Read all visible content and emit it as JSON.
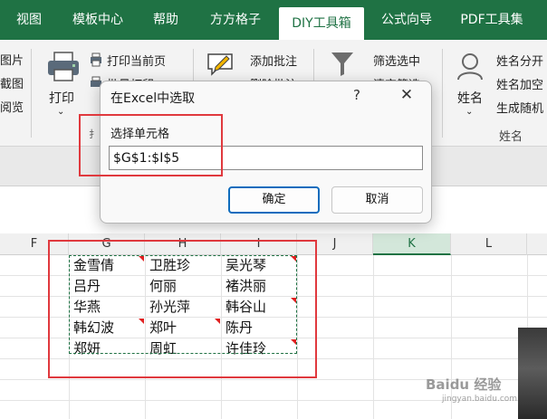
{
  "tabs": [
    {
      "label": "视图"
    },
    {
      "label": "模板中心"
    },
    {
      "label": "帮助"
    },
    {
      "label": "方方格子"
    },
    {
      "label": "DIY工具箱",
      "active": true
    },
    {
      "label": "公式向导"
    },
    {
      "label": "PDF工具集"
    }
  ],
  "ribbon": {
    "left_fragments": [
      "图片",
      "截图",
      "阅览"
    ],
    "print": {
      "label": "打印",
      "print_current_page": "打印当前页",
      "batch_print_partial": "批量打印"
    },
    "comments": {
      "add_comment": "添加批注",
      "delete_comment_partial": "删除批注"
    },
    "filter": {
      "filter_selected": "筛选选中",
      "clear_filter_partial": "清空筛选"
    },
    "name": {
      "label": "姓名",
      "split_name": "姓名分开",
      "add_space": "姓名加空",
      "generate_random": "生成随机",
      "group_label": "姓名"
    }
  },
  "dialog": {
    "title": "在Excel中选取",
    "help_symbol": "?",
    "close_symbol": "✕",
    "label": "选择单元格",
    "value": "$G$1:$I$5",
    "ok_label": "确定",
    "cancel_label": "取消"
  },
  "columns": [
    "F",
    "G",
    "H",
    "I",
    "J",
    "K",
    "L"
  ],
  "selected_column": "K",
  "table": {
    "rows": [
      [
        "金雪倩",
        "卫胜珍",
        "吴光琴"
      ],
      [
        "吕丹",
        "何丽",
        "褚洪丽"
      ],
      [
        "华燕",
        "孙光萍",
        "韩谷山"
      ],
      [
        "韩幻波",
        "郑叶",
        "陈丹"
      ],
      [
        "郑妍",
        "周虹",
        "许佳玲"
      ]
    ]
  },
  "colors": {
    "accent": "#1f7244",
    "highlight_box": "#e0393e",
    "comment_marker": "#e02020",
    "primary_button_border": "#0f6cbd"
  },
  "watermark": {
    "text": "Baidu 经验",
    "subtext": "jingyan.baidu.com"
  }
}
